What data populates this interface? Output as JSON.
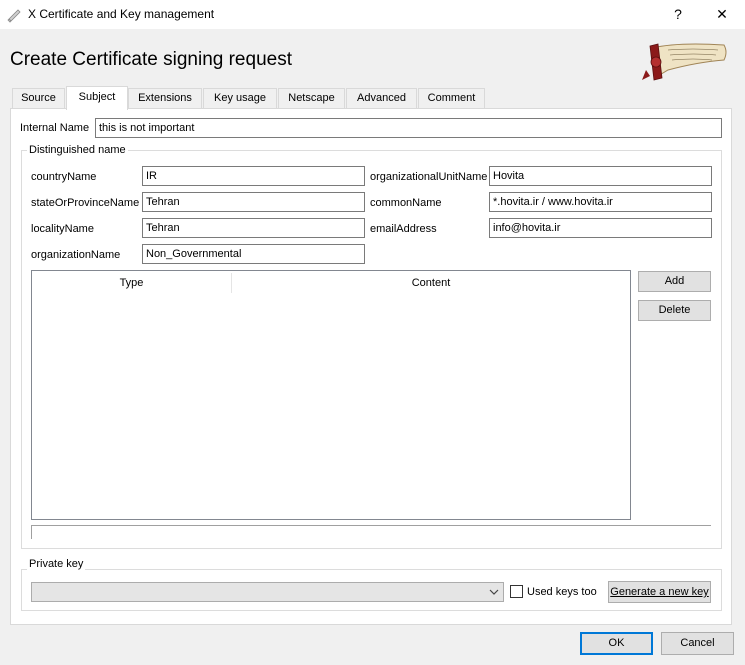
{
  "window": {
    "title": "X Certificate and Key management",
    "help_label": "?",
    "close_label": "✕"
  },
  "heading": "Create Certificate signing request",
  "tabs": [
    {
      "label": "Source"
    },
    {
      "label": "Subject"
    },
    {
      "label": "Extensions"
    },
    {
      "label": "Key usage"
    },
    {
      "label": "Netscape"
    },
    {
      "label": "Advanced"
    },
    {
      "label": "Comment"
    }
  ],
  "active_tab": "Subject",
  "internal_name": {
    "label": "Internal Name",
    "value": "this is not important"
  },
  "distinguished_name": {
    "title": "Distinguished name",
    "fields": {
      "countryName": {
        "label": "countryName",
        "value": "IR"
      },
      "stateOrProvinceName": {
        "label": "stateOrProvinceName",
        "value": "Tehran"
      },
      "localityName": {
        "label": "localityName",
        "value": "Tehran"
      },
      "organizationName": {
        "label": "organizationName",
        "value": "Non_Governmental"
      },
      "organizationalUnitName": {
        "label": "organizationalUnitName",
        "value": "Hovita"
      },
      "commonName": {
        "label": "commonName",
        "value": "*.hovita.ir / www.hovita.ir"
      },
      "emailAddress": {
        "label": "emailAddress",
        "value": "info@hovita.ir"
      }
    },
    "table": {
      "columns": [
        "Type",
        "Content"
      ],
      "rows": []
    },
    "add_label": "Add",
    "delete_label": "Delete"
  },
  "private_key": {
    "title": "Private key",
    "selected": "",
    "used_keys_label": "Used keys too",
    "used_keys_checked": false,
    "generate_label": "Generate a new key"
  },
  "dialog_buttons": {
    "ok": "OK",
    "cancel": "Cancel"
  },
  "colors": {
    "accent": "#0078d7",
    "button_bg": "#e1e1e1",
    "logo_red": "#8b1a1a"
  }
}
